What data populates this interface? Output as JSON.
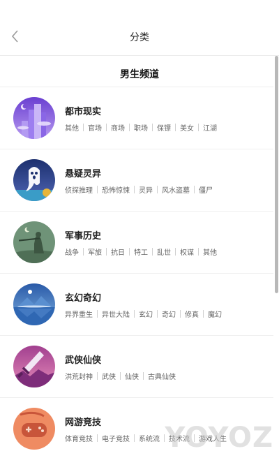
{
  "header": {
    "title": "分类"
  },
  "channel": {
    "title": "男生频道"
  },
  "categories": [
    {
      "name": "都市现实",
      "icon": "city-icon",
      "tags": [
        "其他",
        "官场",
        "商场",
        "职场",
        "保镖",
        "美女",
        "江湖"
      ]
    },
    {
      "name": "悬疑灵异",
      "icon": "ghost-icon",
      "tags": [
        "侦探推理",
        "恐怖惊悚",
        "灵异",
        "风水盗墓",
        "僵尸"
      ]
    },
    {
      "name": "军事历史",
      "icon": "soldier-icon",
      "tags": [
        "战争",
        "军旅",
        "抗日",
        "特工",
        "乱世",
        "权谋",
        "其他"
      ]
    },
    {
      "name": "玄幻奇幻",
      "icon": "mountain-lake-icon",
      "tags": [
        "异界重生",
        "异世大陆",
        "玄幻",
        "奇幻",
        "修真",
        "魔幻"
      ]
    },
    {
      "name": "武侠仙侠",
      "icon": "sword-icon",
      "tags": [
        "洪荒封神",
        "武侠",
        "仙侠",
        "古典仙侠"
      ]
    },
    {
      "name": "网游竞技",
      "icon": "gamepad-icon",
      "tags": [
        "体育竞技",
        "电子竞技",
        "系统流",
        "技术流",
        "游戏人生"
      ]
    }
  ],
  "watermark": "YOYOZ",
  "colors": {
    "accent_purple": "#7a4fd6",
    "text": "#222222",
    "tag_text": "#666666"
  }
}
